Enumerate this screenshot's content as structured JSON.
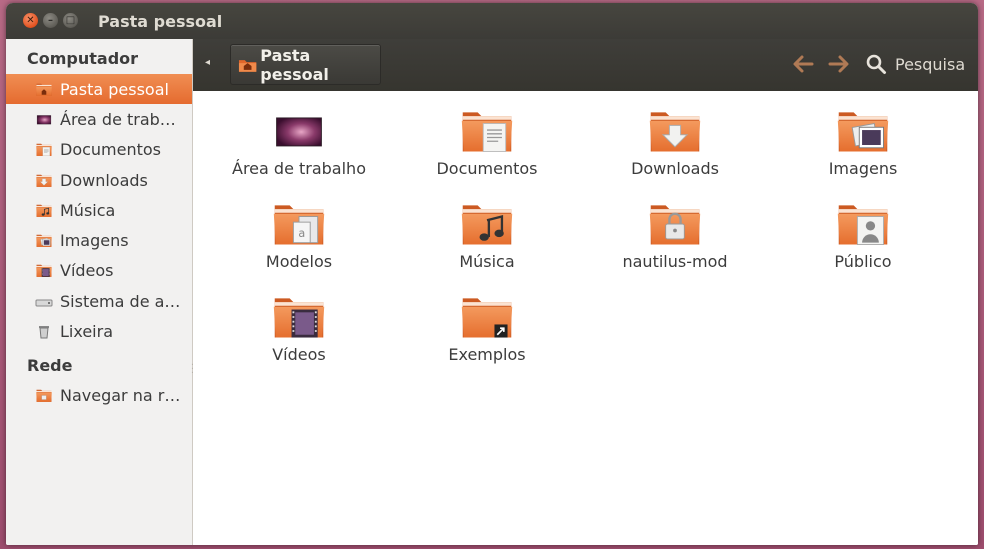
{
  "window": {
    "title": "Pasta pessoal"
  },
  "sidebar": {
    "sections": [
      {
        "heading": "Computador",
        "items": [
          {
            "label": "Pasta pessoal",
            "icon": "home-folder-icon",
            "active": true
          },
          {
            "label": "Área de trab…",
            "icon": "desktop-icon"
          },
          {
            "label": "Documentos",
            "icon": "documents-folder-icon"
          },
          {
            "label": "Downloads",
            "icon": "downloads-folder-icon"
          },
          {
            "label": "Música",
            "icon": "music-folder-icon"
          },
          {
            "label": "Imagens",
            "icon": "pictures-folder-icon"
          },
          {
            "label": "Vídeos",
            "icon": "videos-folder-icon"
          },
          {
            "label": "Sistema de a…",
            "icon": "drive-icon"
          },
          {
            "label": "Lixeira",
            "icon": "trash-icon"
          }
        ]
      },
      {
        "heading": "Rede",
        "items": [
          {
            "label": "Navegar na r…",
            "icon": "network-folder-icon"
          }
        ]
      }
    ]
  },
  "toolbar": {
    "path_label": "Pasta pessoal",
    "search_label": "Pesquisa"
  },
  "files": [
    {
      "label": "Área de trabalho",
      "icon": "desktop-icon"
    },
    {
      "label": "Documentos",
      "icon": "documents-folder-icon"
    },
    {
      "label": "Downloads",
      "icon": "downloads-folder-icon"
    },
    {
      "label": "Imagens",
      "icon": "pictures-folder-icon"
    },
    {
      "label": "Modelos",
      "icon": "templates-folder-icon"
    },
    {
      "label": "Música",
      "icon": "music-folder-icon"
    },
    {
      "label": "nautilus-mod",
      "icon": "locked-folder-icon"
    },
    {
      "label": "Público",
      "icon": "public-folder-icon"
    },
    {
      "label": "Vídeos",
      "icon": "videos-folder-icon"
    },
    {
      "label": "Exemplos",
      "icon": "examples-folder-icon"
    }
  ],
  "colors": {
    "accent": "#e96d33",
    "titlebar": "#3c3b37",
    "folder": "#f08a4b"
  }
}
